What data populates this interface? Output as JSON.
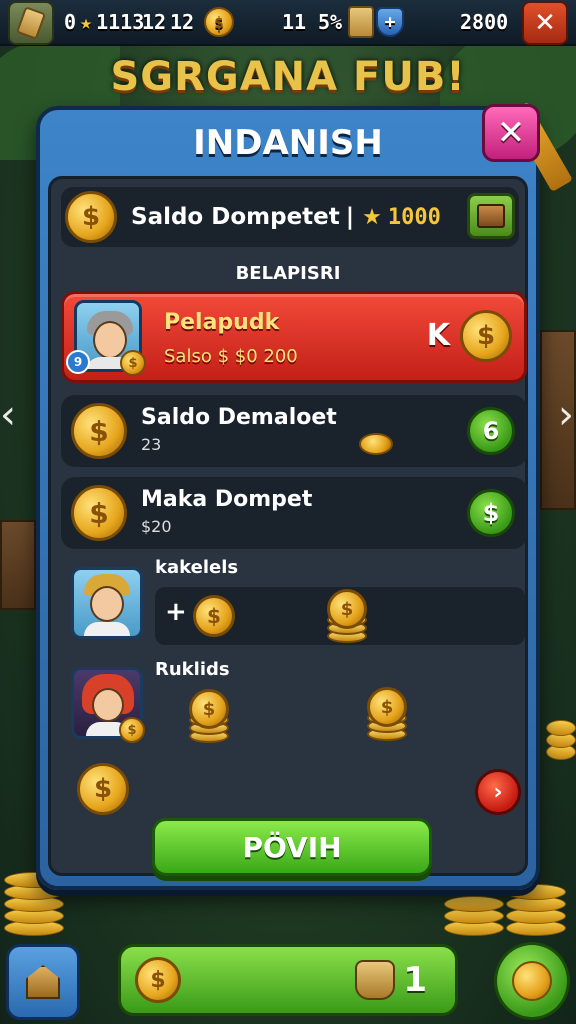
{
  "topbar": {
    "stat_left": "0",
    "stat_a": "1113",
    "stat_b": "12",
    "stat_c": "12",
    "stat_d": "11",
    "stat_percent": "5%",
    "stat_gold": "2800",
    "close_symbol": "✕"
  },
  "game_title": "SGRGANA FUB!",
  "modal": {
    "title": "INDANISH",
    "close_symbol": "✕",
    "balance_label": "Saldo Dompetet",
    "balance_sep": "|",
    "balance_value": "1000",
    "section_label": "BELAPISRI",
    "player": {
      "name": "Pelapudk",
      "sub": "Salso $ $0 200",
      "rank": "K",
      "badge": "9"
    },
    "rows": [
      {
        "title": "Saldo Demaloet",
        "sub": "23",
        "action": "6"
      },
      {
        "title": "Maka Dompet",
        "sub": "$20",
        "action": "$"
      }
    ],
    "friends_label": "kakelels",
    "plus": "+",
    "results_label": "Ruklids",
    "red_btn": "›",
    "confirm": "PÖVIH"
  },
  "bottombar": {
    "count": "1"
  },
  "icons": [
    "coin-icon",
    "star-icon",
    "shield-icon",
    "scroll-icon",
    "wallet-icon",
    "home-icon",
    "bag-icon",
    "close-icon"
  ],
  "colors": {
    "modal_blue": "#3d84c9",
    "player_red": "#e03a2a",
    "confirm_green": "#5cc62a",
    "gold": "#f5c63a",
    "close_pink": "#e04a9a"
  }
}
